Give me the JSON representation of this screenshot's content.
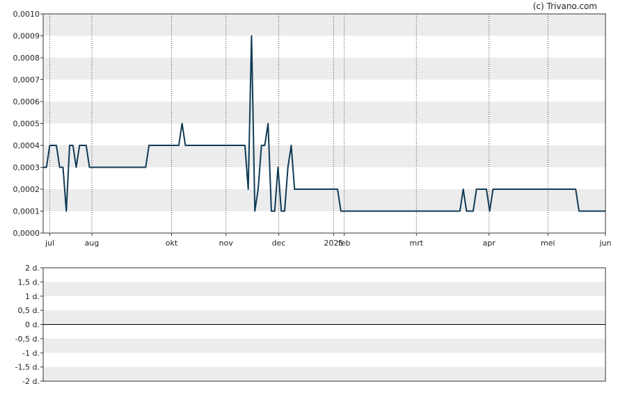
{
  "copyright": "(c) Trivano.com",
  "colors": {
    "line": "#0f3a55",
    "band": "#ececec",
    "frame": "#333333",
    "vgrid": "#444444"
  },
  "chart_data": [
    {
      "type": "line",
      "title": "",
      "xlabel": "",
      "ylabel": "",
      "ylim": [
        0,
        0.001
      ],
      "y_ticks": [
        "0,0000",
        "0,0001",
        "0,0002",
        "0,0003",
        "0,0004",
        "0,0005",
        "0,0006",
        "0,0007",
        "0,0008",
        "0,0009",
        "0,0010"
      ],
      "x_ticks": [
        "jul",
        "aug",
        "okt",
        "nov",
        "dec",
        "2025",
        "feb",
        "mrt",
        "apr",
        "mei",
        "jun"
      ],
      "grid": "alternating horizontal bands, dotted vertical lines at month ticks",
      "series": [
        {
          "values": [
            0.0003,
            0.0003,
            0.0004,
            0.0004,
            0.0004,
            0.0003,
            0.0003,
            0.0001,
            0.0004,
            0.0004,
            0.0003,
            0.0004,
            0.0004,
            0.0004,
            0.0003,
            0.0003,
            0.0003,
            0.0003,
            0.0003,
            0.0003,
            0.0003,
            0.0003,
            0.0003,
            0.0003,
            0.0003,
            0.0003,
            0.0003,
            0.0003,
            0.0003,
            0.0003,
            0.0003,
            0.0003,
            0.0004,
            0.0004,
            0.0004,
            0.0004,
            0.0004,
            0.0004,
            0.0004,
            0.0004,
            0.0004,
            0.0004,
            0.0005,
            0.0004,
            0.0004,
            0.0004,
            0.0004,
            0.0004,
            0.0004,
            0.0004,
            0.0004,
            0.0004,
            0.0004,
            0.0004,
            0.0004,
            0.0004,
            0.0004,
            0.0004,
            0.0004,
            0.0004,
            0.0004,
            0.0004,
            0.0002,
            0.0009,
            0.0001,
            0.0002,
            0.0004,
            0.0004,
            0.0005,
            0.0001,
            0.0001,
            0.0003,
            0.0001,
            0.0001,
            0.0003,
            0.0004,
            0.0002,
            0.0002,
            0.0002,
            0.0002,
            0.0002,
            0.0002,
            0.0002,
            0.0002,
            0.0002,
            0.0002,
            0.0002,
            0.0002,
            0.0002,
            0.0002,
            0.0001,
            0.0001,
            0.0001,
            0.0001,
            0.0001,
            0.0001,
            0.0001,
            0.0001,
            0.0001,
            0.0001,
            0.0001,
            0.0001,
            0.0001,
            0.0001,
            0.0001,
            0.0001,
            0.0001,
            0.0001,
            0.0001,
            0.0001,
            0.0001,
            0.0001,
            0.0001,
            0.0001,
            0.0001,
            0.0001,
            0.0001,
            0.0001,
            0.0001,
            0.0001,
            0.0001,
            0.0001,
            0.0001,
            0.0001,
            0.0001,
            0.0001,
            0.0001,
            0.0002,
            0.0001,
            0.0001,
            0.0001,
            0.0002,
            0.0002,
            0.0002,
            0.0002,
            0.0001,
            0.0002,
            0.0002,
            0.0002,
            0.0002,
            0.0002,
            0.0002,
            0.0002,
            0.0002,
            0.0002,
            0.0002,
            0.0002,
            0.0002,
            0.0002,
            0.0002,
            0.0002,
            0.0002,
            0.0002,
            0.0002,
            0.0002,
            0.0002,
            0.0002,
            0.0002,
            0.0002,
            0.0002,
            0.0002,
            0.0002,
            0.0001,
            0.0001,
            0.0001,
            0.0001,
            0.0001,
            0.0001,
            0.0001,
            0.0001,
            0.0001
          ]
        }
      ]
    },
    {
      "type": "line",
      "title": "",
      "xlabel": "",
      "ylabel": "",
      "ylim": [
        -2,
        2
      ],
      "y_ticks": [
        "2 d.",
        "1,5 d.",
        "1 d.",
        "0,5 d.",
        "0 d.",
        "-0,5 d.",
        "-1 d.",
        "-1,5 d.",
        "-2 d."
      ],
      "series": []
    }
  ]
}
